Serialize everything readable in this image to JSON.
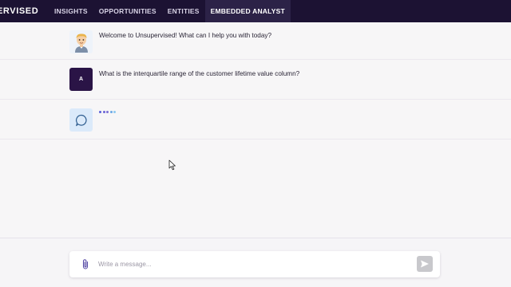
{
  "header": {
    "brand": "ERVISED",
    "nav": [
      {
        "label": "INSIGHTS"
      },
      {
        "label": "OPPORTUNITIES"
      },
      {
        "label": "ENTITIES"
      },
      {
        "label": "EMBEDDED ANALYST",
        "active": true
      }
    ],
    "bg_color": "#1c1233"
  },
  "chat": {
    "messages": [
      {
        "sender": "assistant",
        "avatar_icon": "memoji-avatar-icon",
        "text": "Welcome to Unsupervised! What can I help you with today?"
      },
      {
        "sender": "user",
        "avatar_initial": "A",
        "text": "What is the interquartile range of the customer lifetime value column?"
      },
      {
        "sender": "assistant",
        "avatar_icon": "chat-bubble-icon",
        "typing_indicator": true
      }
    ],
    "typing_dot_colors": [
      "#5a5fd8",
      "#6b64d6",
      "#7a6fd4",
      "#6aa8e6",
      "#8cc8f0"
    ]
  },
  "composer": {
    "placeholder": "Write a message...",
    "attach_icon": "paperclip-icon",
    "send_icon": "send-icon"
  }
}
